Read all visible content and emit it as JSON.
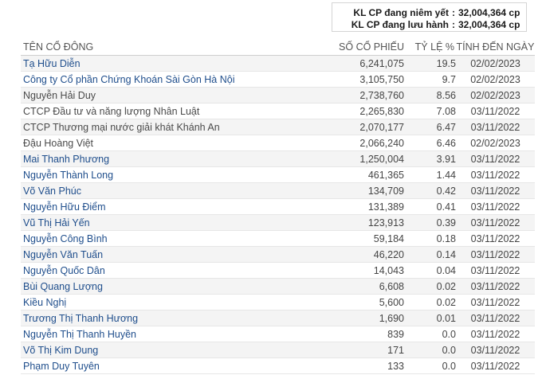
{
  "summary": {
    "listed_label": "KL CP đang niêm yết",
    "listed_value": "32,004,364 cp",
    "outstanding_label": "KL CP đang lưu hành",
    "outstanding_value": "32,004,364 cp",
    "separator": ":"
  },
  "table": {
    "headers": {
      "name": "TÊN CỔ ĐÔNG",
      "shares": "SỐ CỔ PHIẾU",
      "percent": "TỶ LỆ %",
      "date": "TÍNH ĐẾN NGÀY"
    },
    "rows": [
      {
        "name": "Tạ Hữu Diễn",
        "shares": "6,241,075",
        "percent": "19.5",
        "date": "02/02/2023",
        "link": true
      },
      {
        "name": "Công ty Cổ phần Chứng Khoán Sài Gòn Hà Nội",
        "shares": "3,105,750",
        "percent": "9.7",
        "date": "02/02/2023",
        "link": true
      },
      {
        "name": "Nguyễn Hải Duy",
        "shares": "2,738,760",
        "percent": "8.56",
        "date": "02/02/2023",
        "link": false
      },
      {
        "name": "CTCP Đầu tư và năng lượng Nhân Luật",
        "shares": "2,265,830",
        "percent": "7.08",
        "date": "03/11/2022",
        "link": false
      },
      {
        "name": "CTCP Thương mại nước giải khát Khánh An",
        "shares": "2,070,177",
        "percent": "6.47",
        "date": "03/11/2022",
        "link": false
      },
      {
        "name": "Đậu Hoàng Việt",
        "shares": "2,066,240",
        "percent": "6.46",
        "date": "02/02/2023",
        "link": false
      },
      {
        "name": "Mai Thanh Phương",
        "shares": "1,250,004",
        "percent": "3.91",
        "date": "03/11/2022",
        "link": true
      },
      {
        "name": "Nguyễn Thành Long",
        "shares": "461,365",
        "percent": "1.44",
        "date": "03/11/2022",
        "link": true
      },
      {
        "name": "Võ Văn Phúc",
        "shares": "134,709",
        "percent": "0.42",
        "date": "03/11/2022",
        "link": true
      },
      {
        "name": "Nguyễn Hữu Điểm",
        "shares": "131,389",
        "percent": "0.41",
        "date": "03/11/2022",
        "link": true
      },
      {
        "name": "Vũ Thị Hải Yến",
        "shares": "123,913",
        "percent": "0.39",
        "date": "03/11/2022",
        "link": true
      },
      {
        "name": "Nguyễn Công Bình",
        "shares": "59,184",
        "percent": "0.18",
        "date": "03/11/2022",
        "link": true
      },
      {
        "name": "Nguyễn Văn Tuấn",
        "shares": "46,220",
        "percent": "0.14",
        "date": "03/11/2022",
        "link": true
      },
      {
        "name": "Nguyễn Quốc Dân",
        "shares": "14,043",
        "percent": "0.04",
        "date": "03/11/2022",
        "link": true
      },
      {
        "name": "Bùi Quang Lượng",
        "shares": "6,608",
        "percent": "0.02",
        "date": "03/11/2022",
        "link": true
      },
      {
        "name": "Kiều Nghị",
        "shares": "5,600",
        "percent": "0.02",
        "date": "03/11/2022",
        "link": true
      },
      {
        "name": "Trương Thị Thanh Hương",
        "shares": "1,690",
        "percent": "0.01",
        "date": "03/11/2022",
        "link": true
      },
      {
        "name": "Nguyễn Thị Thanh Huyền",
        "shares": "839",
        "percent": "0.0",
        "date": "03/11/2022",
        "link": true
      },
      {
        "name": "Võ Thị Kim Dung",
        "shares": "171",
        "percent": "0.0",
        "date": "03/11/2022",
        "link": true
      },
      {
        "name": "Phạm Duy Tuyên",
        "shares": "133",
        "percent": "0.0",
        "date": "03/11/2022",
        "link": true
      }
    ]
  },
  "colors": {
    "link_text": "#1f4e8c",
    "plain_text": "#4a4a4a",
    "stripe": "#f4f4f4"
  }
}
